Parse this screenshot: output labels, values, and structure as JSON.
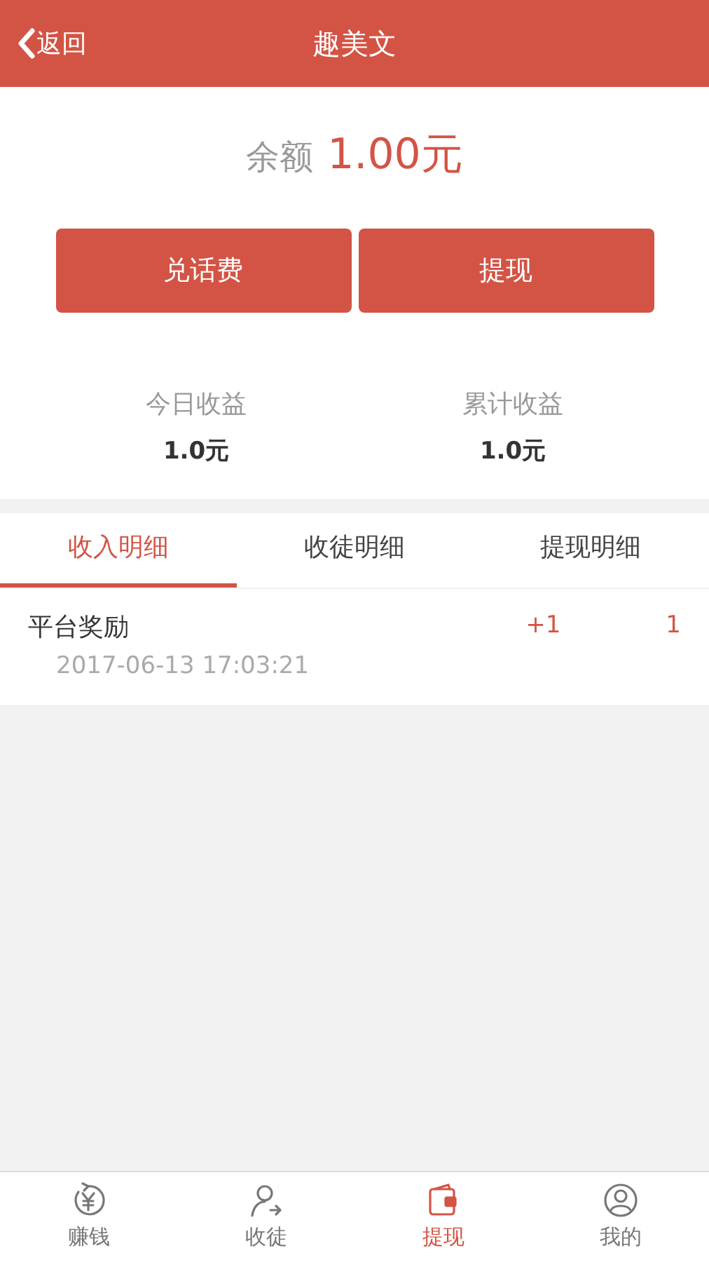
{
  "header": {
    "back": "返回",
    "title": "趣美文"
  },
  "balance": {
    "label": "余额",
    "amount": "1.00元"
  },
  "buttons": [
    "兑话费",
    "提现"
  ],
  "stats": [
    {
      "label": "今日收益",
      "value": "1.0元"
    },
    {
      "label": "累计收益",
      "value": "1.0元"
    }
  ],
  "tabs": [
    {
      "label": "收入明细",
      "selected": true
    },
    {
      "label": "收徒明细",
      "selected": false
    },
    {
      "label": "提现明细",
      "selected": false
    }
  ],
  "records": [
    {
      "title": "平台奖励",
      "time": "2017-06-13 17:03:21",
      "change": "+1",
      "total": "1"
    }
  ],
  "bottom_nav": [
    {
      "kind": "earn",
      "label": "赚钱",
      "selected": false
    },
    {
      "kind": "apprentice",
      "label": "收徒",
      "selected": false
    },
    {
      "kind": "wallet",
      "label": "提现",
      "selected": true
    },
    {
      "kind": "profile",
      "label": "我的",
      "selected": false
    }
  ]
}
